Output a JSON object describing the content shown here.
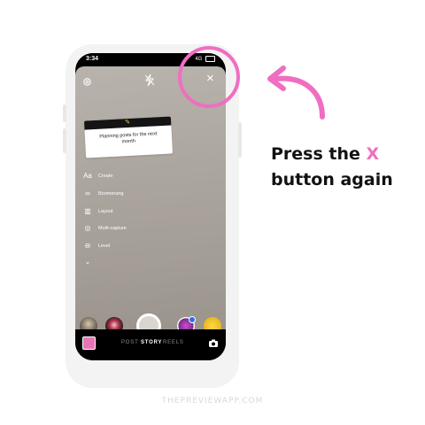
{
  "status_bar": {
    "time": "3:34",
    "network": "4G"
  },
  "top_controls": {
    "settings_icon": "gear-icon",
    "flash_icon": "flash-off-icon",
    "close_icon": "close-icon",
    "close_label": "×"
  },
  "sticker": {
    "emoji": "✎",
    "text": "Planning posts for the next month"
  },
  "tools": [
    {
      "icon": "Aa",
      "label": "Create"
    },
    {
      "icon": "∞",
      "label": "Boomerang"
    },
    {
      "icon": "▥",
      "label": "Layout"
    },
    {
      "icon": "◎",
      "label": "Multi-capture"
    },
    {
      "icon": "⊖",
      "label": "Level"
    },
    {
      "icon": "⌄",
      "label": ""
    }
  ],
  "bottom_bar": {
    "modes": [
      "POST",
      "STORY",
      "REELS"
    ],
    "active_mode": "STORY"
  },
  "caption": {
    "line1_before": "Press the ",
    "line1_accent": "X",
    "line2": "button again"
  },
  "footer": "THEPREVIEWAPP.COM",
  "colors": {
    "accent": "#f06ec2",
    "gallery_thumb": "#e874b6"
  }
}
